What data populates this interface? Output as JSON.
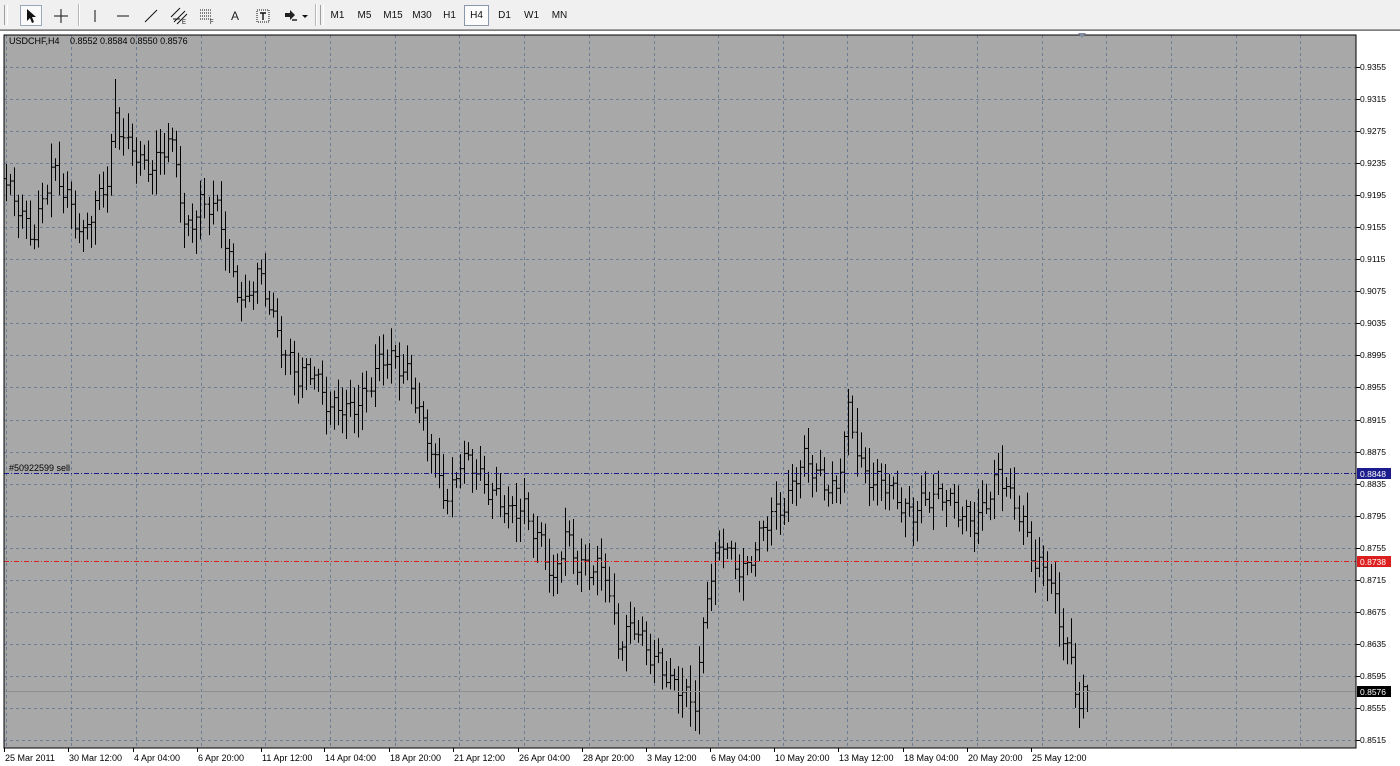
{
  "toolbar": {
    "tools": [
      {
        "name": "cursor-tool-button",
        "icon": "cursor-arrow-icon",
        "active": true
      },
      {
        "name": "crosshair-tool-button",
        "icon": "crosshair-icon"
      },
      {
        "name": "vertical-line-tool-button",
        "icon": "vertical-line-icon"
      },
      {
        "name": "horizontal-line-tool-button",
        "icon": "horizontal-line-icon"
      },
      {
        "name": "trendline-tool-button",
        "icon": "trendline-icon"
      },
      {
        "name": "equidistant-channel-tool-button",
        "icon": "equidistant-channel-icon"
      },
      {
        "name": "fibonacci-tool-button",
        "icon": "fibonacci-retracement-icon"
      },
      {
        "name": "text-tool-button",
        "icon": "text-a-icon",
        "label": "A"
      },
      {
        "name": "text-label-tool-button",
        "icon": "text-label-icon",
        "label": "T"
      },
      {
        "name": "arrows-dropdown-button",
        "icon": "arrows-dropdown-icon"
      }
    ],
    "timeframes": [
      "M1",
      "M5",
      "M15",
      "M30",
      "H1",
      "H4",
      "D1",
      "W1",
      "MN"
    ],
    "active_timeframe": "H4"
  },
  "colors": {
    "chart_bg": "#a8a8a8",
    "grid": "#6e7e92",
    "bars": "#000000",
    "order_line": "#1c1c8c",
    "order_label_bg": "#1c1c8c",
    "stop_line": "#dc1e1e",
    "stop_label_bg": "#dc1e1e",
    "bid_line": "#8e8e8e",
    "bid_label_bg": "#000000"
  },
  "chart_data": {
    "type": "ohlc",
    "symbol_label": "USDCHF,H4",
    "ohlc_label": "0.8552 0.8584 0.8550 0.8576",
    "ylim": [
      0.8505,
      0.9395
    ],
    "y_ticks": [
      "0.9355",
      "0.9315",
      "0.9275",
      "0.9235",
      "0.9195",
      "0.9155",
      "0.9115",
      "0.9075",
      "0.9035",
      "0.8995",
      "0.8955",
      "0.8915",
      "0.8875",
      "0.8835",
      "0.8795",
      "0.8755",
      "0.8715",
      "0.8675",
      "0.8635",
      "0.8595",
      "0.8555",
      "0.8515"
    ],
    "x_labels": [
      "25 Mar 2011",
      "30 Mar 12:00",
      "4 Apr 04:00",
      "6 Apr 20:00",
      "11 Apr 12:00",
      "14 Apr 04:00",
      "18 Apr 20:00",
      "21 Apr 12:00",
      "26 Apr 04:00",
      "28 Apr 20:00",
      "3 May 12:00",
      "6 May 04:00",
      "10 May 20:00",
      "13 May 12:00",
      "18 May 04:00",
      "20 May 20:00",
      "25 May 12:00"
    ],
    "grid": true,
    "order": {
      "label": "#50922599 sell",
      "price": "0.8848"
    },
    "stop_level": {
      "price": "0.8738"
    },
    "bid": {
      "price": "0.8576"
    },
    "anchors": [
      {
        "i": 0,
        "p": 0.92
      },
      {
        "i": 3,
        "p": 0.918
      },
      {
        "i": 7,
        "p": 0.915
      },
      {
        "i": 11,
        "p": 0.922
      },
      {
        "i": 15,
        "p": 0.92
      },
      {
        "i": 19,
        "p": 0.914
      },
      {
        "i": 23,
        "p": 0.919
      },
      {
        "i": 25,
        "p": 0.922
      },
      {
        "i": 27,
        "p": 0.93
      },
      {
        "i": 30,
        "p": 0.925
      },
      {
        "i": 34,
        "p": 0.923
      },
      {
        "i": 38,
        "p": 0.925
      },
      {
        "i": 40,
        "p": 0.926
      },
      {
        "i": 42,
        "p": 0.923
      },
      {
        "i": 44,
        "p": 0.915
      },
      {
        "i": 48,
        "p": 0.919
      },
      {
        "i": 52,
        "p": 0.917
      },
      {
        "i": 56,
        "p": 0.91
      },
      {
        "i": 59,
        "p": 0.906
      },
      {
        "i": 62,
        "p": 0.909
      },
      {
        "i": 65,
        "p": 0.906
      },
      {
        "i": 69,
        "p": 0.9
      },
      {
        "i": 72,
        "p": 0.896
      },
      {
        "i": 76,
        "p": 0.898
      },
      {
        "i": 80,
        "p": 0.893
      },
      {
        "i": 84,
        "p": 0.892
      },
      {
        "i": 88,
        "p": 0.895
      },
      {
        "i": 92,
        "p": 0.898
      },
      {
        "i": 96,
        "p": 0.899
      },
      {
        "i": 99,
        "p": 0.898
      },
      {
        "i": 103,
        "p": 0.89
      },
      {
        "i": 106,
        "p": 0.886
      },
      {
        "i": 109,
        "p": 0.882
      },
      {
        "i": 112,
        "p": 0.886
      },
      {
        "i": 116,
        "p": 0.885
      },
      {
        "i": 120,
        "p": 0.883
      },
      {
        "i": 124,
        "p": 0.879
      },
      {
        "i": 128,
        "p": 0.881
      },
      {
        "i": 132,
        "p": 0.876
      },
      {
        "i": 135,
        "p": 0.87
      },
      {
        "i": 138,
        "p": 0.878
      },
      {
        "i": 141,
        "p": 0.874
      },
      {
        "i": 144,
        "p": 0.872
      },
      {
        "i": 148,
        "p": 0.873
      },
      {
        "i": 151,
        "p": 0.864
      },
      {
        "i": 155,
        "p": 0.865
      },
      {
        "i": 158,
        "p": 0.863
      },
      {
        "i": 161,
        "p": 0.862
      },
      {
        "i": 164,
        "p": 0.858
      },
      {
        "i": 168,
        "p": 0.857
      },
      {
        "i": 170,
        "p": 0.857
      },
      {
        "i": 173,
        "p": 0.87
      },
      {
        "i": 177,
        "p": 0.876
      },
      {
        "i": 180,
        "p": 0.874
      },
      {
        "i": 183,
        "p": 0.873
      },
      {
        "i": 186,
        "p": 0.876
      },
      {
        "i": 189,
        "p": 0.88
      },
      {
        "i": 193,
        "p": 0.882
      },
      {
        "i": 197,
        "p": 0.886
      },
      {
        "i": 201,
        "p": 0.885
      },
      {
        "i": 205,
        "p": 0.882
      },
      {
        "i": 208,
        "p": 0.892
      },
      {
        "i": 212,
        "p": 0.885
      },
      {
        "i": 216,
        "p": 0.883
      },
      {
        "i": 220,
        "p": 0.882
      },
      {
        "i": 224,
        "p": 0.88
      },
      {
        "i": 228,
        "p": 0.881
      },
      {
        "i": 232,
        "p": 0.883
      },
      {
        "i": 236,
        "p": 0.879
      },
      {
        "i": 239,
        "p": 0.878
      },
      {
        "i": 242,
        "p": 0.882
      },
      {
        "i": 245,
        "p": 0.885
      },
      {
        "i": 248,
        "p": 0.881
      },
      {
        "i": 251,
        "p": 0.879
      },
      {
        "i": 254,
        "p": 0.874
      },
      {
        "i": 257,
        "p": 0.872
      },
      {
        "i": 260,
        "p": 0.866
      },
      {
        "i": 263,
        "p": 0.862
      },
      {
        "i": 265,
        "p": 0.856
      },
      {
        "i": 267,
        "p": 0.8576
      }
    ]
  }
}
